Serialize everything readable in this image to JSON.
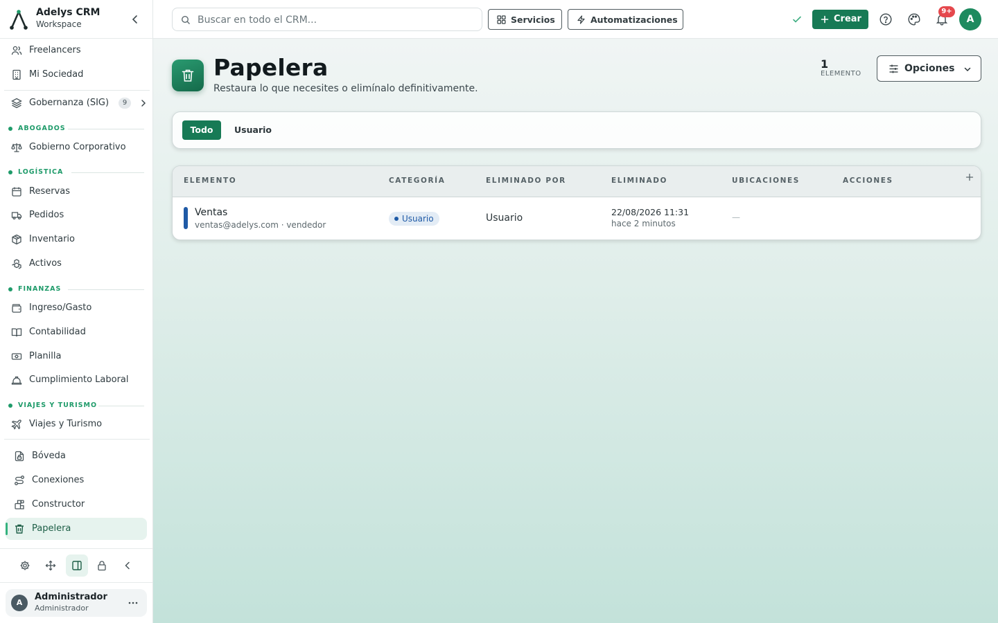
{
  "brand": {
    "name": "Adelys CRM",
    "subtitle": "Workspace"
  },
  "sidebar": {
    "top_items": [
      {
        "label": "Freelancers",
        "icon": "users-icon"
      },
      {
        "label": "Mi Sociedad",
        "icon": "building-icon"
      }
    ],
    "governance": {
      "label": "Gobernanza (SIG)",
      "count": "9",
      "icon": "layers-icon"
    },
    "sections": [
      {
        "title": "ABOGADOS",
        "items": [
          {
            "label": "Gobierno Corporativo",
            "icon": "scale-icon"
          }
        ]
      },
      {
        "title": "LOGÍSTICA",
        "items": [
          {
            "label": "Reservas",
            "icon": "calendar-icon"
          },
          {
            "label": "Pedidos",
            "icon": "truck-icon"
          },
          {
            "label": "Inventario",
            "icon": "package-icon"
          },
          {
            "label": "Activos",
            "icon": "boxes-icon"
          }
        ]
      },
      {
        "title": "FINANZAS",
        "items": [
          {
            "label": "Ingreso/Gasto",
            "icon": "wallet-icon"
          },
          {
            "label": "Contabilidad",
            "icon": "book-icon"
          },
          {
            "label": "Planilla",
            "icon": "banknote-icon"
          },
          {
            "label": "Cumplimiento Laboral",
            "icon": "hard-hat-icon"
          }
        ]
      },
      {
        "title": "VIAJES Y TURISMO",
        "items": [
          {
            "label": "Viajes y Turismo",
            "icon": "plane-icon"
          }
        ]
      }
    ],
    "bottom_items": [
      {
        "label": "Bóveda",
        "icon": "file-lock-icon"
      },
      {
        "label": "Conexiones",
        "icon": "route-icon"
      },
      {
        "label": "Constructor",
        "icon": "blocks-icon"
      },
      {
        "label": "Papelera",
        "icon": "trash-icon",
        "active": true
      }
    ],
    "tools": [
      "gear-icon",
      "move-icon",
      "panel-icon",
      "lock-icon",
      "chevron-left-icon"
    ],
    "user": {
      "initial": "A",
      "name": "Administrador",
      "role": "Administrador"
    }
  },
  "topbar": {
    "search_placeholder": "Buscar en todo el CRM...",
    "services_label": "Servicios",
    "automations_label": "Automatizaciones",
    "create_label": "Crear",
    "notification_count": "9+",
    "avatar_initial": "A"
  },
  "page": {
    "title": "Papelera",
    "subtitle": "Restaura lo que necesites o elimínalo definitivamente.",
    "count": "1",
    "count_label": "ELEMENTO",
    "options_label": "Opciones"
  },
  "filters": [
    {
      "label": "Todo",
      "active": true
    },
    {
      "label": "Usuario",
      "active": false
    }
  ],
  "table": {
    "columns": [
      "ELEMENTO",
      "CATEGORÍA",
      "ELIMINADO POR",
      "ELIMINADO",
      "UBICACIONES",
      "ACCIONES"
    ],
    "rows": [
      {
        "name": "Ventas",
        "meta": "ventas@adelys.com · vendedor",
        "category": "Usuario",
        "deleted_by": "Usuario",
        "deleted_at": "22/08/2026 11:31",
        "deleted_ago": "hace 2 minutos",
        "locations": "—"
      }
    ]
  },
  "colors": {
    "accent": "#177a55",
    "accent_light": "#e6f3ee",
    "category_blue": "#1f5aa6",
    "danger": "#e5484d"
  }
}
